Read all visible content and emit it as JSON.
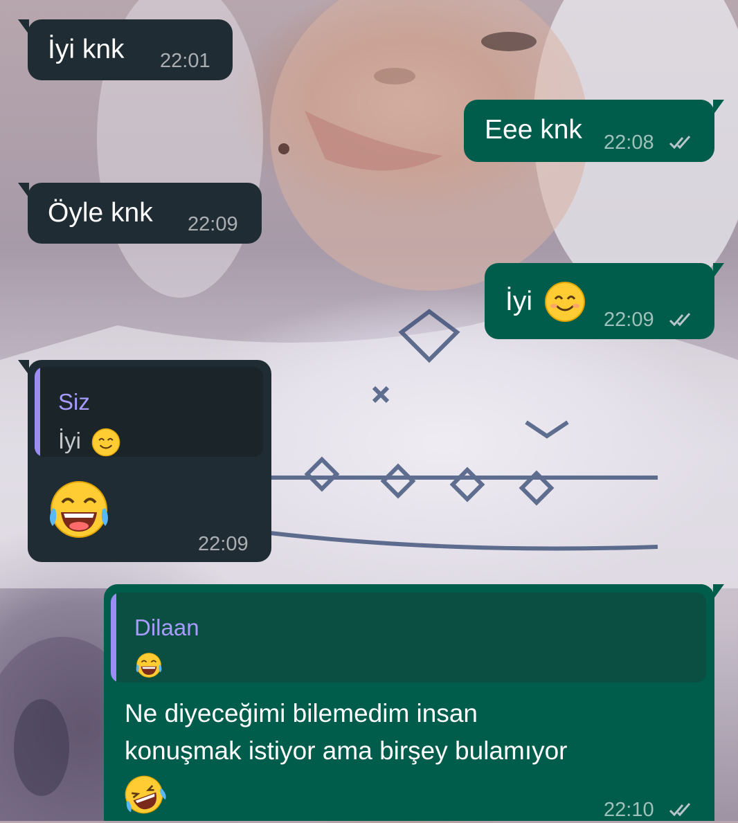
{
  "chat": {
    "messages": [
      {
        "direction": "incoming",
        "text": "İyi knk",
        "time": "22:01"
      },
      {
        "direction": "outgoing",
        "text": "Eee knk",
        "time": "22:08",
        "status_icon": "double-check-icon"
      },
      {
        "direction": "incoming",
        "text": "Öyle knk",
        "time": "22:09"
      },
      {
        "direction": "outgoing",
        "text": "İyi",
        "emoji": "smiling-face-icon",
        "time": "22:09",
        "status_icon": "double-check-icon"
      },
      {
        "direction": "incoming",
        "reply_author": "Siz",
        "reply_text": "İyi",
        "reply_emoji": "smiling-face-icon",
        "emoji": "tears-of-joy-icon",
        "time": "22:09"
      },
      {
        "direction": "outgoing",
        "reply_author": "Dilaan",
        "reply_emoji": "tears-of-joy-icon",
        "text_line1": "Ne diyeceğimi bilemedim insan",
        "text_line2": "konuşmak istiyor ama birşey bulamıyor",
        "emoji": "rolling-laughing-icon",
        "time": "22:10",
        "status_icon": "double-check-icon"
      }
    ]
  },
  "colors": {
    "incoming_bubble": "#202c33",
    "outgoing_bubble": "#005c4b",
    "quote_author": "#a89bff",
    "tick_color": "#b9c6cc"
  }
}
